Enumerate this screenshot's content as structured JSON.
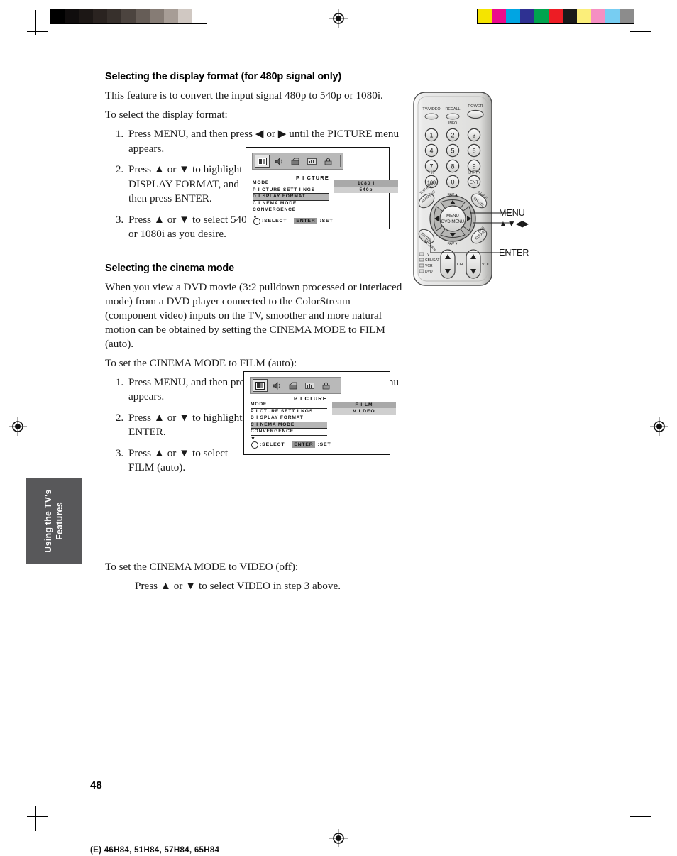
{
  "page": {
    "number": "48",
    "footer_code": "(E) 46H84, 51H84, 57H84, 65H84",
    "side_tab": "Using the TV's\nFeatures"
  },
  "section1": {
    "title": "Selecting the display format (for 480p signal only)",
    "intro": "This feature is to convert the input signal 480p to 540p or 1080i.",
    "lead": "To select the display format:",
    "steps": [
      "Press MENU, and then press ◀ or ▶ until the PICTURE menu appears.",
      "Press ▲ or ▼ to highlight DISPLAY FORMAT, and then press ENTER.",
      "Press ▲ or ▼ to select 540p or 1080i as you desire."
    ]
  },
  "section2": {
    "title": "Selecting the cinema mode",
    "intro": "When you view a DVD movie (3:2 pulldown processed or interlaced mode) from a DVD player connected to the ColorStream (component video) inputs on the TV, smoother and more natural motion can be obtained by setting the CINEMA MODE to FILM (auto).",
    "lead": "To set the CINEMA MODE to FILM (auto):",
    "steps": [
      "Press MENU, and then press ◀ or ▶ until the PICTURE menu appears.",
      "Press ▲ or ▼ to highlight CINEMA MODE, and then press ENTER.",
      "Press ▲ or ▼ to select FILM (auto)."
    ],
    "video_lead": "To set the CINEMA MODE to VIDEO (off):",
    "video_step": "Press ▲ or ▼ to select VIDEO in step 3 above."
  },
  "osd_display_format": {
    "heading": "P I CTURE",
    "rows": [
      {
        "label": "MODE",
        "highlighted": false
      },
      {
        "label": "P I CTURE  SETT I NGS",
        "highlighted": false
      },
      {
        "label": "D I SPLAY  FORMAT",
        "highlighted": true
      },
      {
        "label": "C I NEMA  MODE",
        "highlighted": false
      },
      {
        "label": "CONVERGENCE",
        "highlighted": false
      }
    ],
    "caret": "▼",
    "values": [
      {
        "label": "1080 i",
        "state": "sel"
      },
      {
        "label": "540p",
        "state": "alt"
      }
    ],
    "footer_select": ":SELECT",
    "footer_enter": "ENTER",
    "footer_set": ":SET",
    "tabs": [
      "picture-icon",
      "audio-icon",
      "video-input-icon",
      "setup-icon",
      "lock-icon"
    ]
  },
  "osd_cinema_mode": {
    "heading": "P I CTURE",
    "rows": [
      {
        "label": "MODE",
        "highlighted": false
      },
      {
        "label": "P I CTURE  SETT I NGS",
        "highlighted": false
      },
      {
        "label": "D I SPLAY  FORMAT",
        "highlighted": false
      },
      {
        "label": "C I NEMA  MODE",
        "highlighted": true
      },
      {
        "label": "CONVERGENCE",
        "highlighted": false
      }
    ],
    "caret": "▼",
    "values": [
      {
        "label": "F I LM",
        "state": "sel"
      },
      {
        "label": "V I DEO",
        "state": "alt"
      }
    ],
    "footer_select": ":SELECT",
    "footer_enter": "ENTER",
    "footer_set": ":SET",
    "tabs": [
      "picture-icon",
      "audio-icon",
      "video-input-icon",
      "setup-icon",
      "lock-icon"
    ]
  },
  "remote": {
    "top_buttons": [
      {
        "label": "TV/VIDEO",
        "sub": ""
      },
      {
        "label": "RECALL",
        "sub": "INFO"
      },
      {
        "label": "POWER",
        "sub": ""
      }
    ],
    "keypad": [
      "1",
      "2",
      "3",
      "4",
      "5",
      "6",
      "7",
      "8",
      "9",
      "100",
      "0",
      "ENT"
    ],
    "keypad_above_left": "+10",
    "keypad_above_right": "CHRTN",
    "center_button": "MENU\nDVD MENU",
    "corner_labels": {
      "top_left": "TOP MENU",
      "top_left_btn": "ADDRESS",
      "top_right": "GUIDE",
      "top_right_btn": "CH·SEL",
      "bottom_left": "ENTER",
      "bottom_left_sub": "RETURN",
      "bottom_right": "EXIT",
      "bottom_right_sub": "CLEAR"
    },
    "fav_up": "FAV▲",
    "fav_down": "FAV▼",
    "ch_label": "CH",
    "vol_label": "VOL",
    "devices": [
      "TV",
      "CBL/SAT",
      "VCR",
      "DVD"
    ]
  },
  "callouts": {
    "menu": "MENU",
    "arrows": "▲▼◀▶",
    "enter": "ENTER"
  },
  "calibration": {
    "gray_patches": [
      "#000000",
      "#100d0d",
      "#1c1715",
      "#2a2320",
      "#37302c",
      "#4c443f",
      "#665d57",
      "#867c75",
      "#a79d96",
      "#d0c8c2",
      "#ffffff"
    ],
    "color_patches": [
      "#f5e400",
      "#ec0a8c",
      "#00a5e3",
      "#2e3192",
      "#00a44f",
      "#ed1c24",
      "#1a1a1a",
      "#fbee7a",
      "#f58fc2",
      "#77cdf2",
      "#8c8c8c"
    ]
  }
}
